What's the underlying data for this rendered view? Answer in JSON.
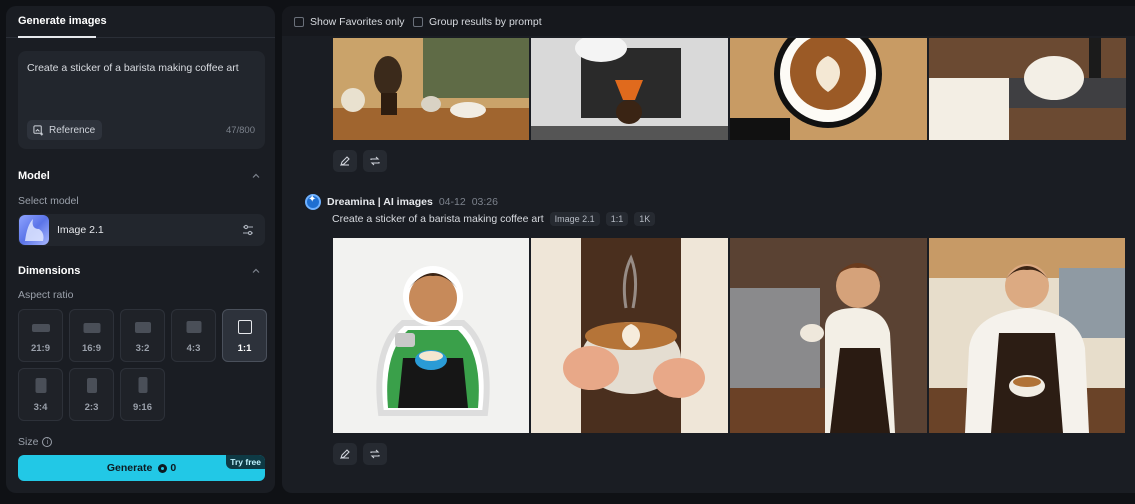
{
  "left_panel": {
    "tab": "Generate images",
    "prompt": "Create a sticker of a barista making coffee art",
    "reference_label": "Reference",
    "char_count": "47/800",
    "model": {
      "section_title": "Model",
      "select_label": "Select model",
      "name": "Image 2.1"
    },
    "dimensions": {
      "section_title": "Dimensions",
      "aspect_label": "Aspect ratio",
      "ratios": [
        "21:9",
        "16:9",
        "3:2",
        "4:3",
        "1:1",
        "3:4",
        "2:3",
        "9:16"
      ],
      "selected": "1:1"
    },
    "size_label": "Size",
    "generate": {
      "label": "Generate",
      "credits": "0",
      "badge": "Try free"
    }
  },
  "right_panel": {
    "filters": {
      "favorites": "Show Favorites only",
      "group": "Group results by prompt"
    },
    "result": {
      "author": "Dreamina | AI images",
      "date": "04-12",
      "time": "03:26",
      "prompt": "Create a sticker of a barista making coffee art",
      "tags": [
        "Image 2.1",
        "1:1",
        "1K"
      ]
    }
  },
  "colors": {
    "accent": "#22c8e6",
    "panel": "#1a1d23",
    "background": "#0f1115"
  }
}
